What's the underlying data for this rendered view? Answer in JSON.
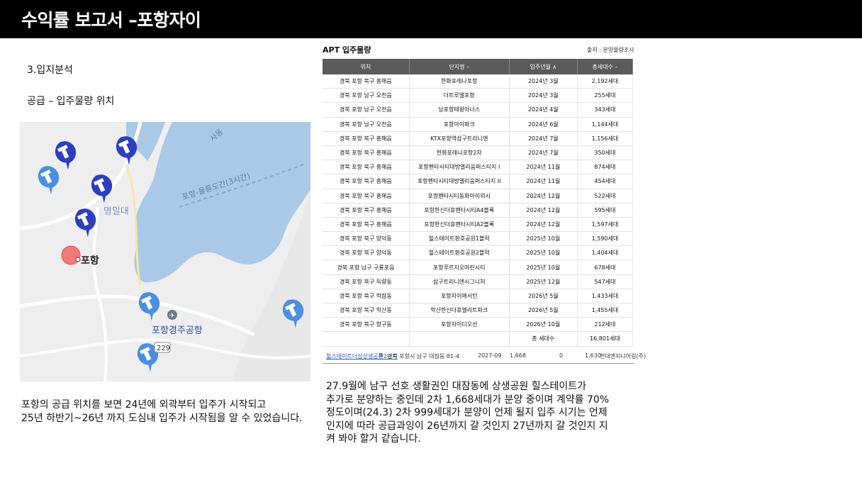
{
  "header": {
    "title": "수익률 보고서 –포항자이"
  },
  "section": {
    "title": "3.입지분석",
    "subtitle": "공급 – 입주물량 위치"
  },
  "map": {
    "labels": {
      "university": "영일대",
      "city": "포항",
      "road": "포항-울릉도간(3시간)",
      "airport": "포항경주공항",
      "route": "229",
      "area": "사동"
    },
    "colors": {
      "sea": "#a9c9e6",
      "land": "#eeeeee",
      "pin": "#2b3fbf",
      "pin_light": "#4a8fe0",
      "marker": "#f07b7b"
    }
  },
  "left_desc": {
    "line1": "포항의 공급 위치를 보면 24년에 외곽부터 입주가 시작되고",
    "line2": "25년 하반기~26년 까지 도심내 입주가 시작됨을 알 수 있었습니다."
  },
  "table": {
    "title": "APT 입주물량",
    "source": "출처 : 분양물량조사",
    "headers": [
      "위치",
      "단지명 –",
      "입주년월 ∧",
      "총세대수 –"
    ],
    "rows": [
      [
        "경북 포항 북구 흥해읍",
        "한화포레나포항",
        "2024년 3월",
        "2,192세대"
      ],
      [
        "경북 포항 남구 오천읍",
        "더트루엘포항",
        "2024년 3월",
        "255세대"
      ],
      [
        "경북 포항 남구 오천읍",
        "남포항태왕아너스",
        "2024년 4월",
        "343세대"
      ],
      [
        "경북 포항 남구 오천읍",
        "포항아이파크",
        "2024년 6월",
        "1,144세대"
      ],
      [
        "경북 포항 북구 흥해읍",
        "KTX포항역삼구트리니엔",
        "2024년 7월",
        "1,156세대"
      ],
      [
        "경북 포항 북구 흥해읍",
        "한화포레나포항2차",
        "2024년 7월",
        "350세대"
      ],
      [
        "경북 포항 북구 흥해읍",
        "포항펜타시티대방엘리움퍼스티지 I",
        "2024년 11월",
        "874세대"
      ],
      [
        "경북 포항 북구 흥해읍",
        "포항펜타시티대방엘리움퍼스티지 II",
        "2024년 11월",
        "454세대"
      ],
      [
        "경북 포항 북구 흥해읍",
        "포항펜타시티동화아이위시",
        "2024년 12월",
        "522세대"
      ],
      [
        "경북 포항 북구 흥해읍",
        "포항한신더휴펜타시티A4블록",
        "2024년 12월",
        "595세대"
      ],
      [
        "경북 포항 북구 흥해읍",
        "포항한신더휴펜타시티A2블록",
        "2024년 12월",
        "1,597세대"
      ],
      [
        "경북 포항 북구 양덕동",
        "힐스테이트환호공원1블럭",
        "2025년 10월",
        "1,590세대"
      ],
      [
        "경북 포항 북구 양덕동",
        "힐스테이트환호공원2블럭",
        "2025년 10월",
        "1,404세대"
      ],
      [
        "경북 포항 남구 구룡포읍",
        "포항푸르지오마린시티",
        "2025년 10월",
        "678세대"
      ],
      [
        "경북 포항 북구 득량동",
        "삼구트리니엔시그니처",
        "2025년 12월",
        "547세대"
      ],
      [
        "경북 포항 북구 학잠동",
        "포항자이애서턴",
        "2026년 5월",
        "1,433세대"
      ],
      [
        "경북 포항 북구 학산동",
        "학산한신더휴엘리트파크",
        "2026년 5월",
        "1,455세대"
      ],
      [
        "경북 포항 북구 항구동",
        "포항자이디오션",
        "2026년 10월",
        "212세대"
      ]
    ],
    "total": {
      "label": "총 세대수",
      "value": "16,801세대"
    }
  },
  "footrow": {
    "name": "힐스테이트더샵상생공원2단지",
    "dots": "⠿",
    "location": "경북 포항시 남구 대잠동 81-4",
    "date": "2027-09",
    "total": "1,668",
    "zero": "0",
    "supply": "1,630",
    "builder": "현대엔지니어링(주)"
  },
  "right_desc": {
    "line1": "27.9월에 남구 선호 생활권인 대잠동에 상생공원 힐스테이트가",
    "line2": "추가로 분양하는 중인데 2차 1,668세대가 분양 중이며 계약률 70%",
    "line3": "정도이며(24.3) 2차 999세대가 분양이 언제 될지 입주 시기는 언제",
    "line4": "인지에 따라 공급과잉이 26년까지 갈 것인지 27년까지 갈 것인지 지",
    "line5": "켜 봐야 할거 같습니다."
  }
}
